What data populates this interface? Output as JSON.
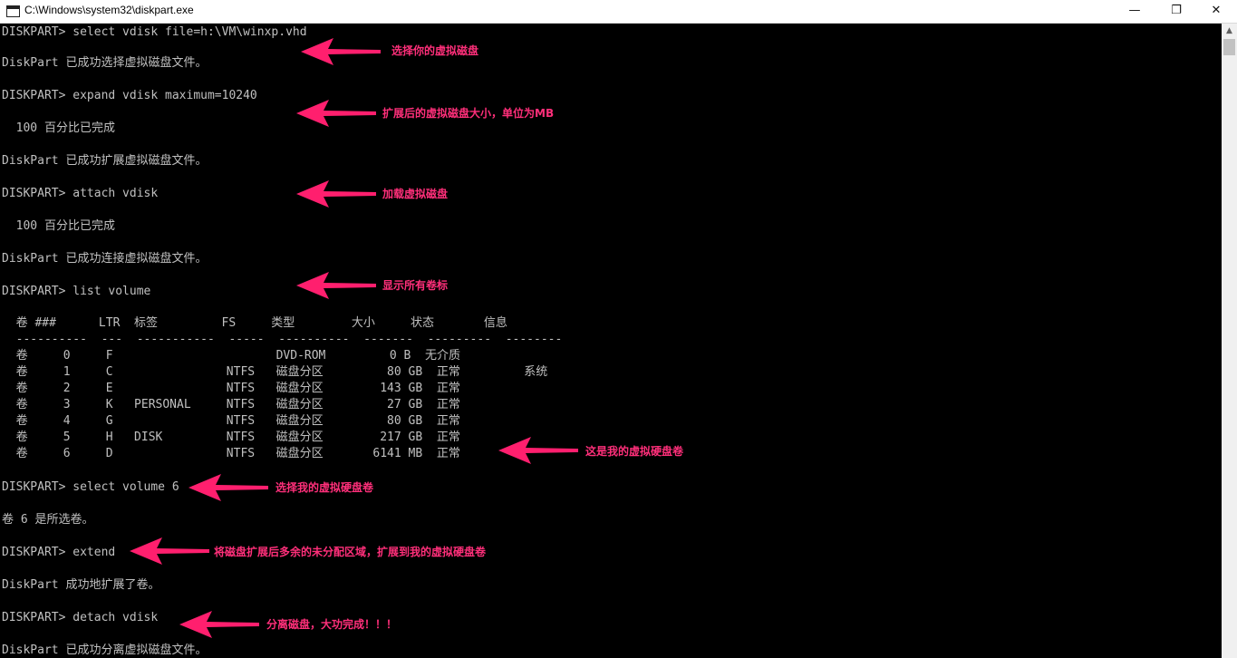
{
  "window": {
    "title": "C:\\Windows\\system32\\diskpart.exe",
    "minimize_glyph": "—",
    "maximize_glyph": "❐",
    "close_glyph": "✕"
  },
  "console": {
    "lines": [
      "DISKPART> select vdisk file=h:\\VM\\winxp.vhd",
      "DiskPart 已成功选择虚拟磁盘文件。",
      "DISKPART> expand vdisk maximum=10240",
      "  100 百分比已完成",
      "DiskPart 已成功扩展虚拟磁盘文件。",
      "DISKPART> attach vdisk",
      "  100 百分比已完成",
      "DiskPart 已成功连接虚拟磁盘文件。",
      "DISKPART> list volume",
      "  卷 ###      LTR  标签         FS     类型        大小     状态       信息",
      "  ----------  ---  -----------  -----  ----------  -------  ---------  --------",
      "  卷     0     F                       DVD-ROM         0 B  无介质",
      "  卷     1     C                NTFS   磁盘分区         80 GB  正常         系统",
      "  卷     2     E                NTFS   磁盘分区        143 GB  正常",
      "  卷     3     K   PERSONAL     NTFS   磁盘分区         27 GB  正常",
      "  卷     4     G                NTFS   磁盘分区         80 GB  正常",
      "  卷     5     H   DISK         NTFS   磁盘分区        217 GB  正常",
      "  卷     6     D                NTFS   磁盘分区       6141 MB  正常",
      "DISKPART> select volume 6",
      "卷 6 是所选卷。",
      "DISKPART> extend",
      "DiskPart 成功地扩展了卷。",
      "DISKPART> detach vdisk",
      "DiskPart 已成功分离虚拟磁盘文件。"
    ]
  },
  "annotations": {
    "color": "#ff1f6e",
    "notes": [
      "选择你的虚拟磁盘",
      "扩展后的虚拟磁盘大小，单位为MB",
      "加载虚拟磁盘",
      "显示所有卷标",
      "这是我的虚拟硬盘卷",
      "选择我的虚拟硬盘卷",
      "将磁盘扩展后多余的未分配区域，扩展到我的虚拟硬盘卷",
      "分离磁盘，大功完成！！！"
    ]
  },
  "scrollbar": {
    "up_glyph": "▲"
  }
}
